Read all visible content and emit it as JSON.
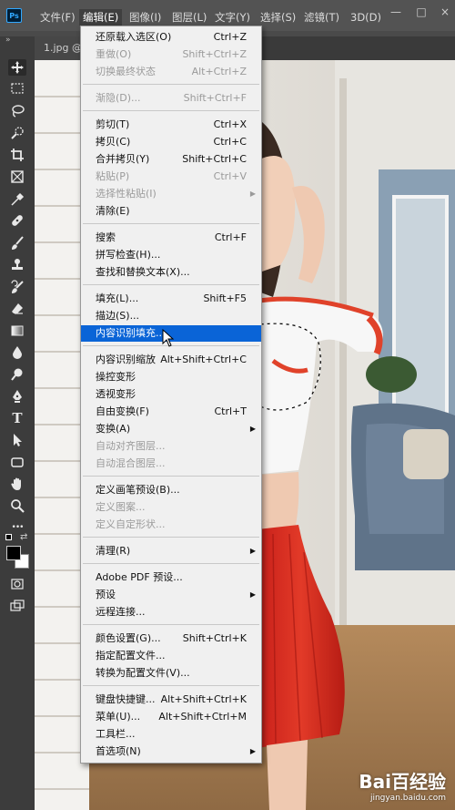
{
  "app": {
    "logo_text": "Ps",
    "accent": "#31a8ff"
  },
  "menubar": {
    "items": [
      "文件(F)",
      "编辑(E)",
      "图像(I)",
      "图层(L)",
      "文字(Y)",
      "选择(S)",
      "滤镜(T)",
      "3D(D)"
    ],
    "active_item": "编辑(E)",
    "window_buttons": [
      "—",
      "□",
      "×"
    ]
  },
  "document_tab": {
    "label": "1.jpg @"
  },
  "edit_menu": {
    "items": [
      {
        "label": "还原载入选区(O)",
        "shortcut": "Ctrl+Z",
        "disabled": false
      },
      {
        "label": "重做(O)",
        "shortcut": "Shift+Ctrl+Z",
        "disabled": true
      },
      {
        "label": "切换最终状态",
        "shortcut": "Alt+Ctrl+Z",
        "disabled": true
      },
      {
        "label": "渐隐(D)...",
        "shortcut": "Shift+Ctrl+F",
        "disabled": true
      },
      {
        "label": "剪切(T)",
        "shortcut": "Ctrl+X",
        "disabled": false
      },
      {
        "label": "拷贝(C)",
        "shortcut": "Ctrl+C",
        "disabled": false
      },
      {
        "label": "合并拷贝(Y)",
        "shortcut": "Shift+Ctrl+C",
        "disabled": false
      },
      {
        "label": "粘贴(P)",
        "shortcut": "Ctrl+V",
        "disabled": true
      },
      {
        "label": "选择性粘贴(I)",
        "shortcut": "",
        "disabled": true,
        "submenu": true
      },
      {
        "label": "清除(E)",
        "shortcut": "",
        "disabled": false
      },
      {
        "label": "搜索",
        "shortcut": "Ctrl+F",
        "disabled": false
      },
      {
        "label": "拼写检查(H)...",
        "shortcut": "",
        "disabled": false
      },
      {
        "label": "查找和替换文本(X)...",
        "shortcut": "",
        "disabled": false
      },
      {
        "label": "填充(L)...",
        "shortcut": "Shift+F5",
        "disabled": false
      },
      {
        "label": "描边(S)...",
        "shortcut": "",
        "disabled": false
      },
      {
        "label": "内容识别填充...",
        "shortcut": "",
        "disabled": false,
        "highlighted": true
      },
      {
        "label": "内容识别缩放",
        "shortcut": "Alt+Shift+Ctrl+C",
        "disabled": false
      },
      {
        "label": "操控变形",
        "shortcut": "",
        "disabled": false
      },
      {
        "label": "透视变形",
        "shortcut": "",
        "disabled": false
      },
      {
        "label": "自由变换(F)",
        "shortcut": "Ctrl+T",
        "disabled": false
      },
      {
        "label": "变换(A)",
        "shortcut": "",
        "disabled": false,
        "submenu": true
      },
      {
        "label": "自动对齐图层...",
        "shortcut": "",
        "disabled": true
      },
      {
        "label": "自动混合图层...",
        "shortcut": "",
        "disabled": true
      },
      {
        "label": "定义画笔预设(B)...",
        "shortcut": "",
        "disabled": false
      },
      {
        "label": "定义图案...",
        "shortcut": "",
        "disabled": true
      },
      {
        "label": "定义自定形状...",
        "shortcut": "",
        "disabled": true
      },
      {
        "label": "清理(R)",
        "shortcut": "",
        "disabled": false,
        "submenu": true
      },
      {
        "label": "Adobe PDF 预设...",
        "shortcut": "",
        "disabled": false
      },
      {
        "label": "预设",
        "shortcut": "",
        "disabled": false,
        "submenu": true
      },
      {
        "label": "远程连接...",
        "shortcut": "",
        "disabled": false
      },
      {
        "label": "颜色设置(G)...",
        "shortcut": "Shift+Ctrl+K",
        "disabled": false
      },
      {
        "label": "指定配置文件...",
        "shortcut": "",
        "disabled": false
      },
      {
        "label": "转换为配置文件(V)...",
        "shortcut": "",
        "disabled": false
      },
      {
        "label": "键盘快捷键...",
        "shortcut": "Alt+Shift+Ctrl+K",
        "disabled": false
      },
      {
        "label": "菜单(U)...",
        "shortcut": "Alt+Shift+Ctrl+M",
        "disabled": false
      },
      {
        "label": "工具栏...",
        "shortcut": "",
        "disabled": false
      },
      {
        "label": "首选项(N)",
        "shortcut": "",
        "disabled": false,
        "submenu": true
      }
    ]
  },
  "toolbar": {
    "tools": [
      "move-tool",
      "marquee-tool",
      "lasso-tool",
      "quick-selection-tool",
      "crop-tool",
      "frame-tool",
      "eyedropper-tool",
      "healing-brush-tool",
      "brush-tool",
      "clone-stamp-tool",
      "history-brush-tool",
      "eraser-tool",
      "gradient-tool",
      "blur-tool",
      "dodge-tool",
      "pen-tool",
      "type-tool",
      "path-selection-tool",
      "rectangle-tool",
      "hand-tool",
      "zoom-tool",
      "more-tools"
    ],
    "type_tool_glyph": "T",
    "more_glyph": "•••",
    "foreground_color": "#000000",
    "background_color": "#ffffff"
  },
  "watermark": {
    "brand": "Bai百经验",
    "url": "jingyan.baidu.com"
  }
}
